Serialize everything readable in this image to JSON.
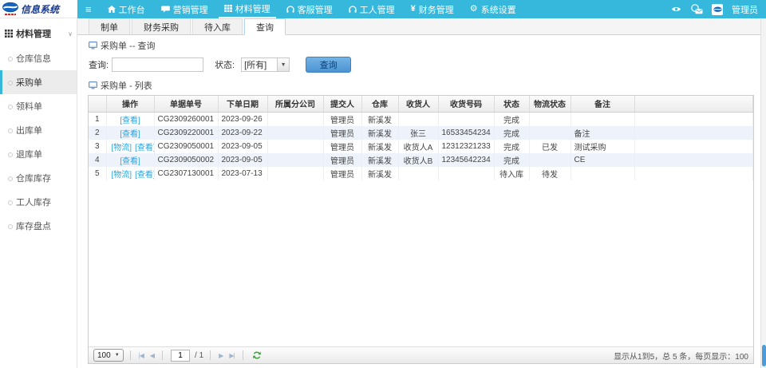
{
  "topbar": {
    "logo_text": "信息系统",
    "nav": [
      {
        "label": "工作台",
        "icon": "home-icon",
        "active": false
      },
      {
        "label": "营销管理",
        "icon": "chat-icon",
        "active": false
      },
      {
        "label": "材料管理",
        "icon": "grid-icon",
        "active": true
      },
      {
        "label": "客服管理",
        "icon": "headset-icon",
        "active": false
      },
      {
        "label": "工人管理",
        "icon": "headset-icon",
        "active": false
      },
      {
        "label": "财务管理",
        "icon": "yen-icon",
        "active": false
      },
      {
        "label": "系统设置",
        "icon": "gear-icon",
        "active": false
      }
    ],
    "right_icons": [
      "eye-icon",
      "message-icon"
    ],
    "user_name": "管理员"
  },
  "sidebar": {
    "header": "材料管理",
    "items": [
      {
        "label": "仓库信息",
        "active": false
      },
      {
        "label": "采购单",
        "active": true
      },
      {
        "label": "领料单",
        "active": false
      },
      {
        "label": "出库单",
        "active": false
      },
      {
        "label": "退库单",
        "active": false
      },
      {
        "label": "仓库库存",
        "active": false
      },
      {
        "label": "工人库存",
        "active": false
      },
      {
        "label": "库存盘点",
        "active": false
      }
    ]
  },
  "tabs": {
    "items": [
      "制单",
      "财务采购",
      "待入库",
      "查询"
    ],
    "active": "查询"
  },
  "query_panel": {
    "title": "采购单 -- 查询",
    "query_label": "查询:",
    "query_value": "",
    "status_label": "状态:",
    "status_value": "[所有]",
    "search_button": "查询"
  },
  "list_panel": {
    "title": "采购单 - 列表"
  },
  "table": {
    "columns": [
      "操作",
      "单据单号",
      "下单日期",
      "所属分公司",
      "提交人",
      "仓库",
      "收货人",
      "收货号码",
      "状态",
      "物流状态",
      "备注"
    ],
    "rows": [
      {
        "num": "1",
        "actions": [
          "[查看]"
        ],
        "cells": [
          "CG2309260001",
          "2023-09-26",
          "",
          "管理员",
          "新溪发",
          "",
          "",
          "完成",
          "",
          ""
        ]
      },
      {
        "num": "2",
        "actions": [
          "[查看]"
        ],
        "cells": [
          "CG2309220001",
          "2023-09-22",
          "",
          "管理员",
          "新溪发",
          "张三",
          "16533454234",
          "完成",
          "",
          "备注"
        ]
      },
      {
        "num": "3",
        "actions": [
          "[物流]",
          "[查看]"
        ],
        "cells": [
          "CG2309050001",
          "2023-09-05",
          "",
          "管理员",
          "新溪发",
          "收货人A",
          "12312321233",
          "完成",
          "已发",
          "测试采购"
        ]
      },
      {
        "num": "4",
        "actions": [
          "[查看]"
        ],
        "cells": [
          "CG2309050002",
          "2023-09-05",
          "",
          "管理员",
          "新溪发",
          "收货人B",
          "12345642234",
          "完成",
          "",
          "CE"
        ]
      },
      {
        "num": "5",
        "actions": [
          "[物流]",
          "[查看]"
        ],
        "cells": [
          "CG2307130001",
          "2023-07-13",
          "",
          "管理员",
          "新溪发",
          "",
          "",
          "待入库",
          "待发",
          ""
        ]
      }
    ]
  },
  "pagination": {
    "page_size": "100",
    "first": "|◀",
    "prev": "◀",
    "page": "1",
    "total_pages": "/ 1",
    "next": "▶",
    "last": "▶|",
    "summary": "显示从1到5，总 5 条，每页显示：100"
  },
  "colors": {
    "topbar_teal": "#35b8dc",
    "link_blue": "#2aa3dc",
    "stripe_blue": "#eef3fb",
    "button_blue": "#4b94d2",
    "logo_navy": "#1a3a8c"
  }
}
